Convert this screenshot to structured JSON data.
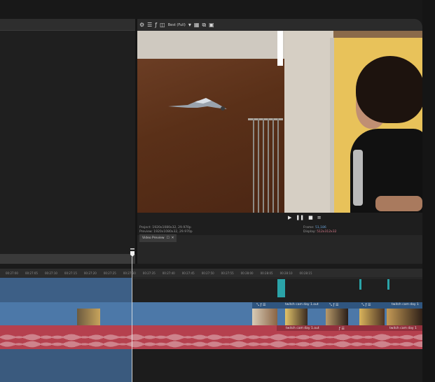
{
  "preview": {
    "toolbar": {
      "quality": "Best (Full)"
    },
    "info": {
      "project_label": "Project:",
      "project_value": "1920x1080x32, 29.970p",
      "preview_label": "Preview:",
      "preview_value": "1920x1080x32, 29.970p",
      "frame_label": "Frame:",
      "frame_value": "51,186",
      "display_label": "Display:",
      "display_value": "512x312x32"
    },
    "tab_label": "Video Preview"
  },
  "timeline": {
    "ruler_ticks": [
      "00:27:00",
      "00:27:05",
      "00:27:10",
      "00:27:15",
      "00:27:20",
      "00:27:25",
      "00:27:30",
      "00:27:35",
      "00:27:40",
      "00:27:45",
      "00:27:50",
      "00:27:55",
      "00:28:00",
      "00:28:05",
      "00:28:10",
      "00:28:15"
    ],
    "video_clips": [
      {
        "label": "twitch cam day 1.out"
      },
      {
        "label": "twitch cam day 1"
      }
    ],
    "audio_clips": [
      {
        "label": "twitch cam day 1.out"
      },
      {
        "label": "twitch cam day 1"
      }
    ]
  },
  "colors": {
    "video_track": "#4c78a8",
    "audio_track": "#b5404e",
    "selection": "#3d5f86",
    "marker": "#2aa3a8"
  }
}
